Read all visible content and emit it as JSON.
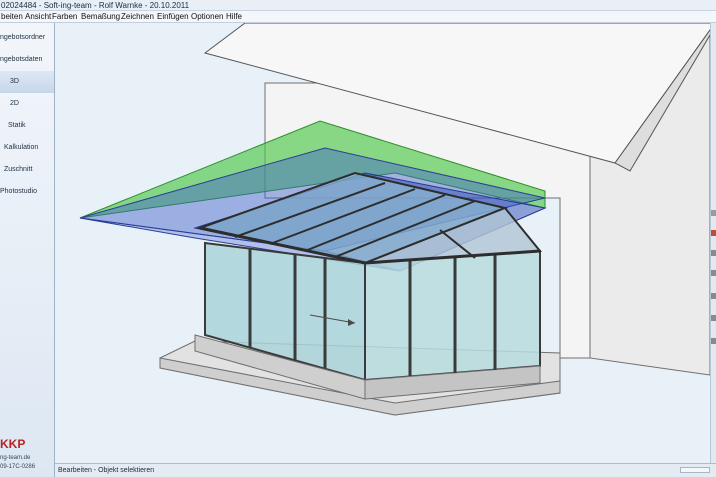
{
  "window": {
    "title": "02024484 - Soft-ing-team - Rolf Warnke - 20.10.2011"
  },
  "menu": {
    "items": [
      "beiten",
      "Ansicht",
      "Farben",
      "Bemaßung",
      "Zeichnen",
      "Einfügen",
      "Optionen",
      "Hilfe"
    ]
  },
  "sidebar": {
    "items": [
      {
        "label": "ngebotsordner",
        "active": false
      },
      {
        "label": "ngebotsdaten",
        "active": false
      },
      {
        "label": "3D",
        "active": true
      },
      {
        "label": "2D",
        "active": false
      },
      {
        "label": "Statik",
        "active": false
      },
      {
        "label": "Kalkulation",
        "active": false
      },
      {
        "label": "Zuschnitt",
        "active": false
      },
      {
        "label": "Photostudio",
        "active": false
      }
    ],
    "logo": "KKP",
    "logo_line1": "ng-team.de",
    "logo_line2": "09-17C-0286"
  },
  "status": {
    "text": "Bearbeiten - Objekt selektieren"
  },
  "colors": {
    "accent_blue": "#3f5fc7",
    "green_plane": "#4fc74a",
    "wall": "#f1f1f1",
    "logo_red": "#b52525"
  },
  "right_strip": {
    "icons": [
      "tool-icon",
      "delete-icon",
      "tool-icon",
      "tool-icon",
      "tool-icon",
      "tool-icon",
      "tool-icon"
    ]
  }
}
